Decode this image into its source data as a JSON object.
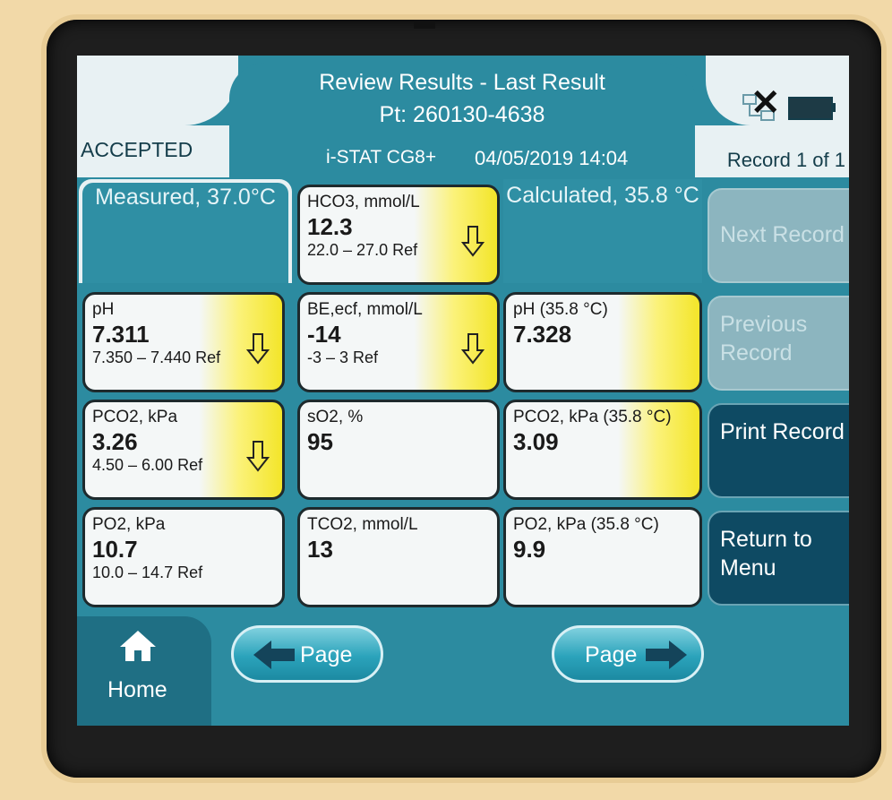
{
  "header": {
    "title": "Review Results - Last Result",
    "patient": "Pt: 260130-4638",
    "status": "ACCEPTED",
    "device": "i-STAT CG8+",
    "datetime": "04/05/2019 14:04",
    "record_counter": "Record 1 of 1"
  },
  "columns": {
    "measured": "Measured, 37.0°C",
    "calculated": "Calculated, 35.8 °C"
  },
  "measured": [
    {
      "label": "pH",
      "value": "7.311",
      "ref": "7.350 – 7.440 Ref",
      "flag": "low"
    },
    {
      "label": "PCO2, kPa",
      "value": "3.26",
      "ref": "4.50 – 6.00 Ref",
      "flag": "low"
    },
    {
      "label": "PO2, kPa",
      "value": "10.7",
      "ref": "10.0 – 14.7 Ref",
      "flag": "none"
    }
  ],
  "middle": [
    {
      "label": "HCO3, mmol/L",
      "value": "12.3",
      "ref": "22.0 – 27.0 Ref",
      "flag": "low"
    },
    {
      "label": "BE,ecf, mmol/L",
      "value": "-14",
      "ref": "-3 – 3 Ref",
      "flag": "low"
    },
    {
      "label": "sO2, %",
      "value": "95",
      "ref": "",
      "flag": "none"
    },
    {
      "label": "TCO2, mmol/L",
      "value": "13",
      "ref": "",
      "flag": "none"
    }
  ],
  "calculated": [
    {
      "label": "pH (35.8 °C)",
      "value": "7.328",
      "flag": "highlight"
    },
    {
      "label": "PCO2, kPa (35.8 °C)",
      "value": "3.09",
      "flag": "highlight"
    },
    {
      "label": "PO2, kPa (35.8 °C)",
      "value": "9.9",
      "flag": "none"
    }
  ],
  "menu": {
    "next_record": "Next Record",
    "previous_record": "Previous Record",
    "print_record": "Print Record",
    "return_to_menu": "Return to Menu"
  },
  "footer": {
    "home": "Home",
    "page_prev": "Page",
    "page_next": "Page"
  },
  "colors": {
    "screen_bg": "#2c8ba0",
    "flag_yellow": "#f3e529",
    "active_button": "#0e4a63",
    "disabled_button": "#8cb5bf"
  },
  "icons": [
    "network-icon",
    "disconnected-x-icon",
    "battery-icon",
    "home-icon",
    "arrow-down-icon",
    "arrow-left-icon",
    "arrow-right-icon"
  ]
}
